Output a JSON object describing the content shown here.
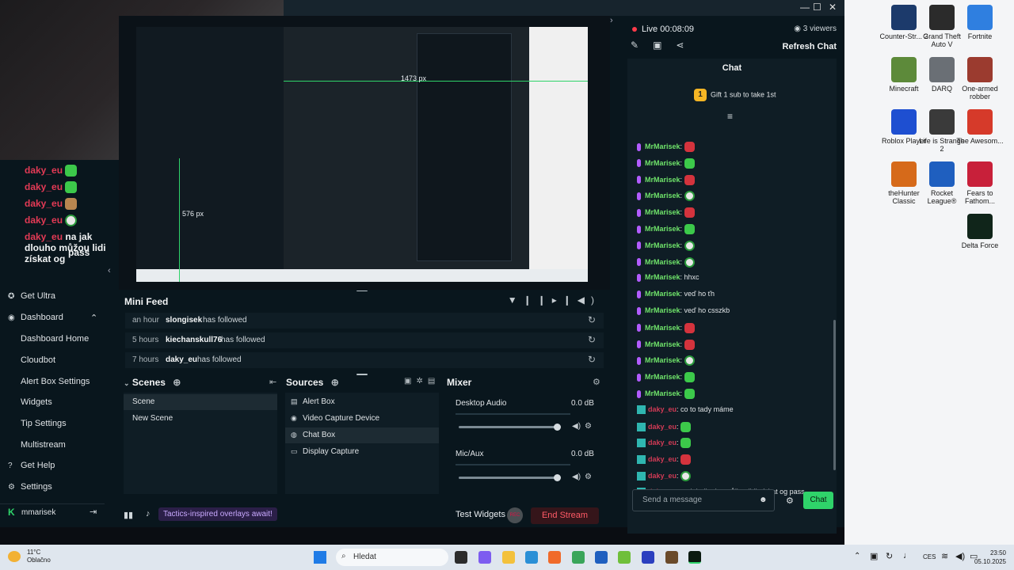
{
  "webcam_chat": [
    {
      "user": "daky_eu",
      "emote": "green"
    },
    {
      "user": "daky_eu",
      "emote": "green"
    },
    {
      "user": "daky_eu",
      "emote": "brown"
    },
    {
      "user": "daky_eu",
      "emote": "white"
    },
    {
      "user": "daky_eu",
      "text": "na jak dlouho můžou lidi získat og",
      "text2": "pass"
    }
  ],
  "preview": {
    "measure_top": "1473 px",
    "measure_left": "576 px"
  },
  "nav": {
    "get_ultra": "Get Ultra",
    "dashboard": "Dashboard",
    "dashboard_home": "Dashboard Home",
    "cloudbot": "Cloudbot",
    "alert_box_settings": "Alert Box Settings",
    "widgets": "Widgets",
    "tip_settings": "Tip Settings",
    "multistream": "Multistream",
    "get_help": "Get Help",
    "settings": "Settings",
    "username": "mmarisek"
  },
  "minifeed": {
    "title": "Mini Feed",
    "rows": [
      {
        "time": "an hour",
        "name": "slongisek",
        "action": "has followed"
      },
      {
        "time": "5 hours",
        "name": "kiechanskull76",
        "action": "has followed"
      },
      {
        "time": "7 hours",
        "name": "daky_eu",
        "action": "has followed"
      }
    ]
  },
  "scenes": {
    "title": "Scenes",
    "items": [
      "Scene",
      "New Scene"
    ]
  },
  "sources": {
    "title": "Sources",
    "items": [
      "Alert Box",
      "Video Capture Device",
      "Chat Box",
      "Display Capture"
    ]
  },
  "mixer": {
    "title": "Mixer",
    "channels": [
      {
        "name": "Desktop Audio",
        "db": "0.0 dB"
      },
      {
        "name": "Mic/Aux",
        "db": "0.0 dB"
      }
    ]
  },
  "bottombar": {
    "promo": "Tactics-inspired overlays await!",
    "test_widgets": "Test Widgets",
    "rec": "REC",
    "end_stream": "End Stream"
  },
  "chat": {
    "live": "Live 00:08:09",
    "viewers": "3 viewers",
    "refresh": "Refresh Chat",
    "title": "Chat",
    "gift": "Gift 1 sub to take 1st",
    "messages": [
      {
        "user": "MrMarisek",
        "emote": "red"
      },
      {
        "user": "MrMarisek",
        "emote": "green"
      },
      {
        "user": "MrMarisek",
        "emote": "red"
      },
      {
        "user": "MrMarisek",
        "emote": "white"
      },
      {
        "user": "MrMarisek",
        "emote": "red"
      },
      {
        "user": "MrMarisek",
        "emote": "green"
      },
      {
        "user": "MrMarisek",
        "emote": "white"
      },
      {
        "user": "MrMarisek",
        "emote": "white"
      },
      {
        "user": "MrMarisek",
        "text": "hhxc"
      },
      {
        "user": "MrMarisek",
        "text": "veď ho ťh"
      },
      {
        "user": "MrMarisek",
        "text": "veď ho csszkb"
      },
      {
        "user": "MrMarisek",
        "emote": "red"
      },
      {
        "user": "MrMarisek",
        "emote": "red"
      },
      {
        "user": "MrMarisek",
        "emote": "white"
      },
      {
        "user": "MrMarisek",
        "emote": "green"
      },
      {
        "user": "MrMarisek",
        "emote": "green"
      },
      {
        "user": "daky_eu",
        "text": "co to tady máme"
      },
      {
        "user": "daky_eu",
        "emote": "green"
      },
      {
        "user": "daky_eu",
        "emote": "green"
      },
      {
        "user": "daky_eu",
        "emote": "red"
      },
      {
        "user": "daky_eu",
        "emote": "white"
      },
      {
        "user": "daky_eu",
        "text": "na jak dlouho můžou lidi získat og pass"
      }
    ],
    "input_placeholder": "Send a message",
    "send": "Chat"
  },
  "desktop_icons": [
    {
      "label": "Counter-Str... 2",
      "color": "#1c3a6b"
    },
    {
      "label": "Grand Theft Auto V",
      "color": "#2b2b2b"
    },
    {
      "label": "Fortnite",
      "color": "#2f7fe0"
    },
    {
      "label": "Minecraft",
      "color": "#5d8a3a"
    },
    {
      "label": "DARQ",
      "color": "#6a6f75"
    },
    {
      "label": "One-armed robber",
      "color": "#9b3b2f"
    },
    {
      "label": "Roblox Player",
      "color": "#1e4fd1"
    },
    {
      "label": "Life is Strange 2",
      "color": "#3a3a3a"
    },
    {
      "label": "The Awesom...",
      "color": "#d63a2a"
    },
    {
      "label": "theHunter Classic",
      "color": "#d66a1a"
    },
    {
      "label": "Rocket League®",
      "color": "#1f5fbf"
    },
    {
      "label": "Fears to Fathom...",
      "color": "#c8203a"
    },
    {
      "label": "Delta Force",
      "color": "#10251a"
    }
  ],
  "taskbar": {
    "temp": "11°C",
    "weather": "Oblačno",
    "search": "Hledat",
    "lang": "CES",
    "time": "23:50",
    "date": "05.10.2025"
  }
}
